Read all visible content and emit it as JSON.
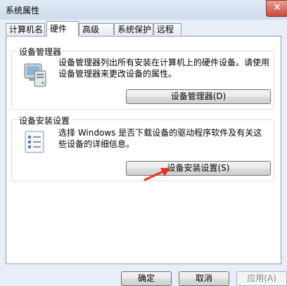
{
  "window": {
    "title": "系统属性",
    "close_label": "×"
  },
  "tabs": [
    {
      "label": "计算机名"
    },
    {
      "label": "硬件"
    },
    {
      "label": "高级"
    },
    {
      "label": "系统保护"
    },
    {
      "label": "远程"
    }
  ],
  "device_manager": {
    "legend": "设备管理器",
    "description": "设备管理器列出所有安装在计算机上的硬件设备。请使用设备管理器来更改设备的属性。",
    "button_label": "设备管理器(D)",
    "icon": "device-manager-icon"
  },
  "device_installation": {
    "legend": "设备安装设置",
    "description": "选择 Windows 是否下载设备的驱动程序软件及有关这些设备的详细信息。",
    "button_label": "设备安装设置(S)",
    "icon": "checklist-icon"
  },
  "footer": {
    "ok_label": "确定",
    "cancel_label": "取消",
    "apply_label": "应用(A)"
  },
  "colors": {
    "annotation_arrow": "#e8321e",
    "focus_border": "#3c7fb1"
  }
}
